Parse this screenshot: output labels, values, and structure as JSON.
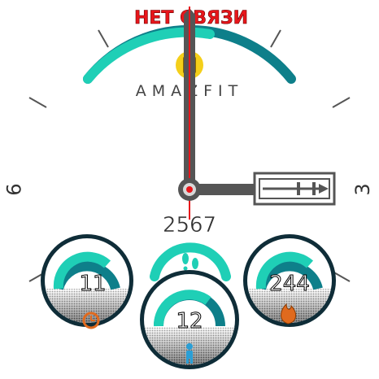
{
  "status": {
    "text": "НЕТ СВЯЗИ",
    "color": "#e8161b"
  },
  "brand": {
    "text": "AMAZFIT"
  },
  "dial": {
    "label_3": "3",
    "label_9": "9"
  },
  "steps": {
    "value": "2567",
    "icon": "footsteps-icon",
    "progress": 0.5
  },
  "battery": {
    "progress": 0.55,
    "icon": "battery-icon"
  },
  "complications": {
    "left": {
      "value": "11",
      "icon": "alarm-clock-icon",
      "progress": 0.8,
      "icon_color": "#e06a1e"
    },
    "center": {
      "value": "12",
      "icon": "person-icon",
      "progress": 0.55,
      "icon_color": "#2a9fd6"
    },
    "right": {
      "value": "244",
      "icon": "flame-icon",
      "progress": 0.8,
      "icon_color": "#e06a1e"
    }
  },
  "colors": {
    "accent": "#1fcfb6",
    "accent_dark": "#0e7f8a",
    "hand_dark": "#555555",
    "second_hand": "#e8161b"
  }
}
